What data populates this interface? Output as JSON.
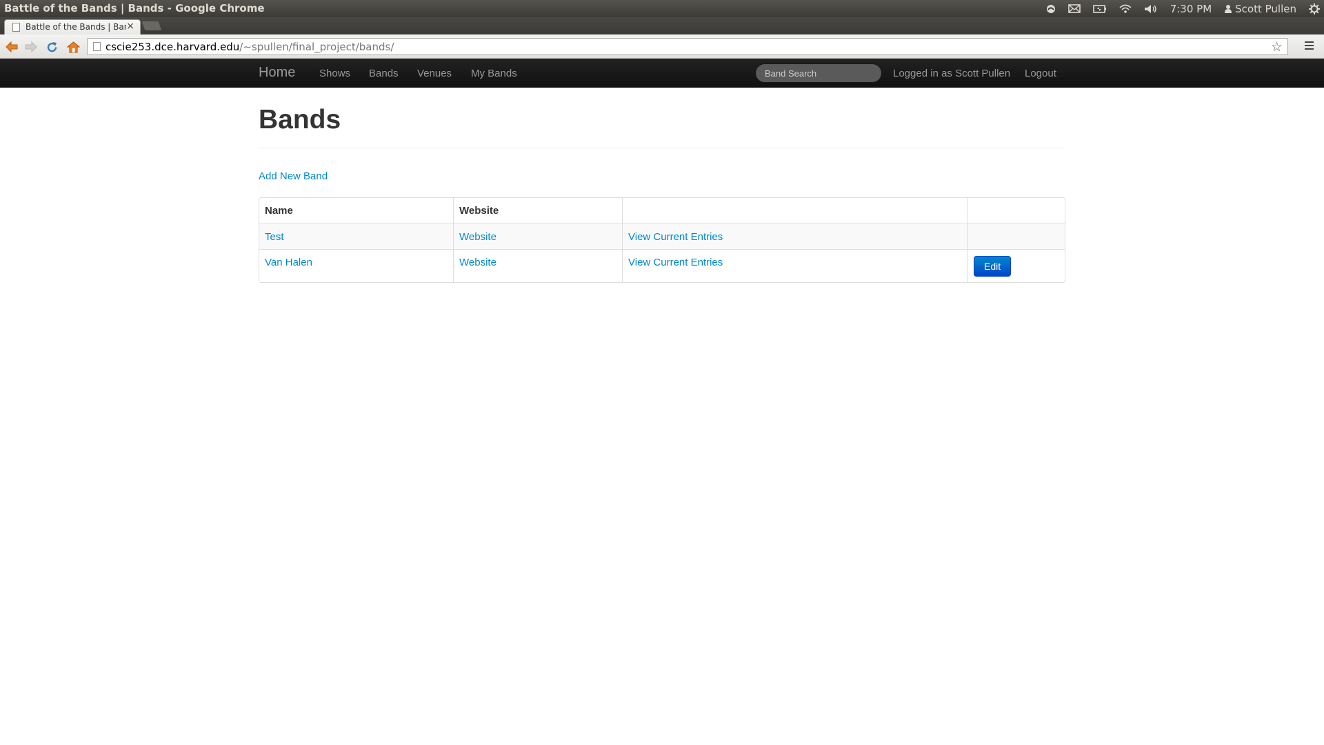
{
  "os": {
    "window_title": "Battle of the Bands | Bands - Google Chrome",
    "clock": "7:30 PM",
    "user": "Scott Pullen"
  },
  "browser": {
    "tab_title": "Battle of the Bands | Bands",
    "tab_close": "×",
    "url_host": "cscie253.dce.harvard.edu",
    "url_path": "/~spullen/final_project/bands/",
    "star": "☆"
  },
  "navbar": {
    "brand": "Home",
    "links": [
      "Shows",
      "Bands",
      "Venues",
      "My Bands"
    ],
    "search_placeholder": "Band Search",
    "logged_in": "Logged in as Scott Pullen",
    "logout": "Logout"
  },
  "page": {
    "title": "Bands",
    "add_link": "Add New Band",
    "table": {
      "headers": [
        "Name",
        "Website",
        "",
        ""
      ],
      "rows": [
        {
          "name": "Test",
          "website": "Website",
          "entries": "View Current Entries",
          "action": ""
        },
        {
          "name": "Van Halen",
          "website": "Website",
          "entries": "View Current Entries",
          "action": "Edit"
        }
      ]
    }
  },
  "colors": {
    "link": "#0088cc",
    "navbar_bg": "#1b1b1b",
    "button_primary": "#0055cc"
  }
}
